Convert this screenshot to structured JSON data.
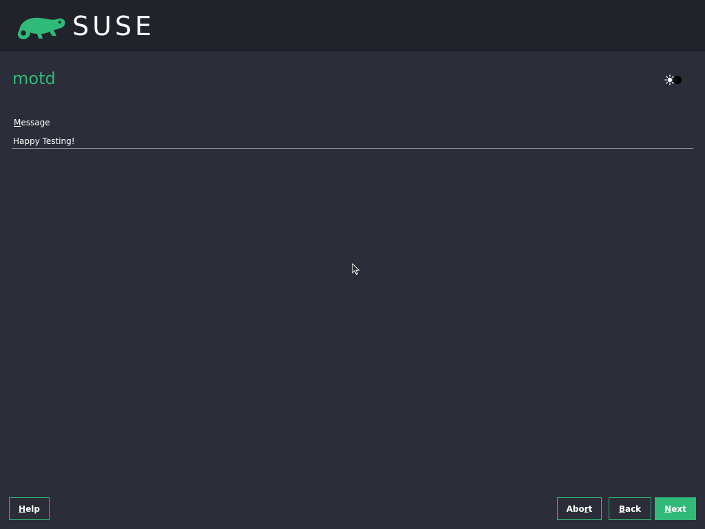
{
  "header": {
    "logo_text": "SUSE",
    "logo_icon": "chameleon-icon",
    "brand_color": "#30ba78"
  },
  "page": {
    "title": "motd",
    "theme_toggle_icon": "sun-moon-icon"
  },
  "form": {
    "message_label_prefix": "M",
    "message_label_rest": "essage",
    "message_value": "Happy Testing!"
  },
  "buttons": {
    "help_prefix": "H",
    "help_rest": "elp",
    "abort_prefix": "Abo",
    "abort_mnemonic": "r",
    "abort_rest": "t",
    "back_prefix": "B",
    "back_rest": "ack",
    "next_prefix": "N",
    "next_rest": "ext"
  },
  "colors": {
    "background": "#2b2d38",
    "header_background": "#21232b",
    "accent": "#30ba78"
  }
}
